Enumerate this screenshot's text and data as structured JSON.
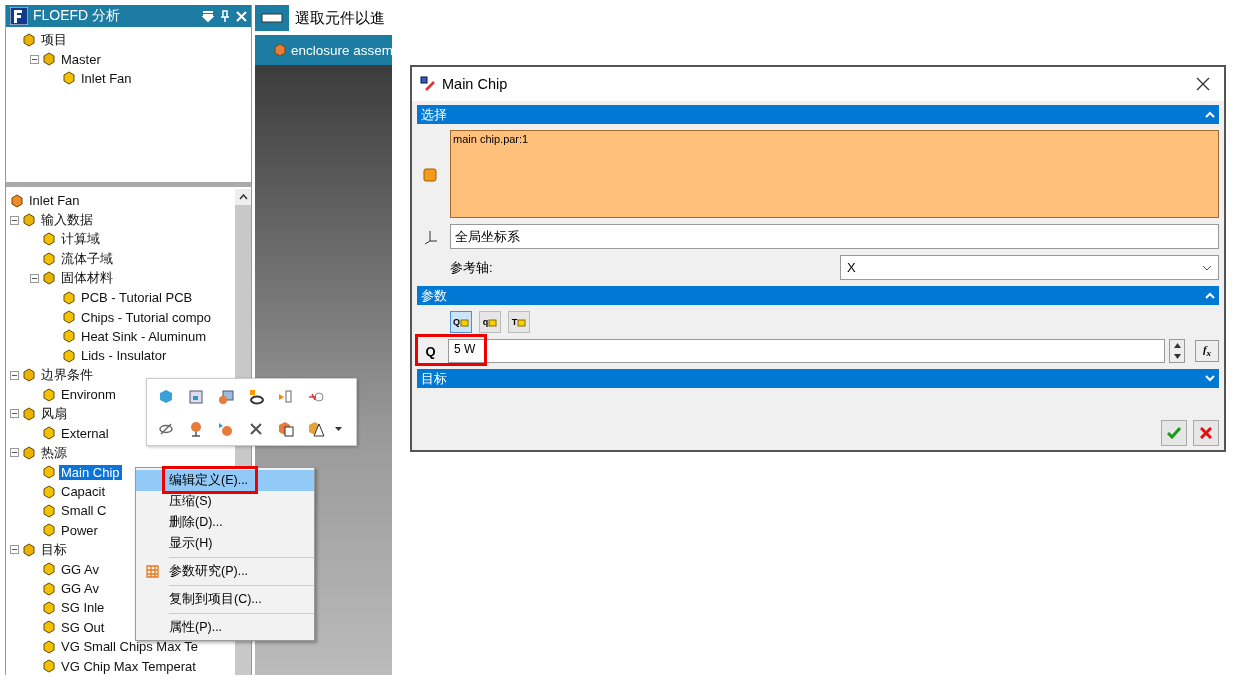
{
  "analysis_panel": {
    "title": "FLOEFD 分析",
    "project_tree": [
      {
        "label": "项目",
        "children": [
          {
            "label": "Master",
            "expanded": true,
            "children": [
              {
                "label": "Inlet Fan"
              }
            ]
          }
        ]
      }
    ]
  },
  "feature_tree": {
    "root": "Inlet Fan",
    "items": [
      {
        "label": "输入数据",
        "expanded": true,
        "children": [
          {
            "label": "计算域"
          },
          {
            "label": "流体子域"
          },
          {
            "label": "固体材料",
            "expanded": true,
            "children": [
              {
                "label": "PCB - Tutorial PCB"
              },
              {
                "label": "Chips - Tutorial compo"
              },
              {
                "label": "Heat Sink - Aluminum"
              },
              {
                "label": "Lids - Insulator"
              }
            ]
          }
        ]
      },
      {
        "label": "边界条件",
        "expanded": true,
        "children": [
          {
            "label": "Environm"
          }
        ]
      },
      {
        "label": "风扇",
        "expanded": true,
        "children": [
          {
            "label": "External"
          }
        ]
      },
      {
        "label": "热源",
        "expanded": true,
        "children": [
          {
            "label": "Main Chip",
            "selected": true
          },
          {
            "label": "Capacit",
            "selected": false
          },
          {
            "label": "Small C",
            "selected": false
          },
          {
            "label": "Power",
            "selected": false
          }
        ]
      },
      {
        "label": "目标",
        "expanded": true,
        "children": [
          {
            "label": "GG Av"
          },
          {
            "label": "GG Av"
          },
          {
            "label": "SG Inle"
          },
          {
            "label": "SG Out"
          },
          {
            "label": "VG Small Chips Max Te"
          },
          {
            "label": "VG Chip Max Temperat"
          }
        ]
      }
    ]
  },
  "viewport": {
    "hint": "選取元件以進",
    "tab": "enclosure assem"
  },
  "context_menu": {
    "items": [
      {
        "kind": "item",
        "label": "编辑定义(E)...",
        "selected": true,
        "highlighted": true
      },
      {
        "kind": "item",
        "label": "压缩(S)",
        "selected": false
      },
      {
        "kind": "item",
        "label": "删除(D)...",
        "selected": false
      },
      {
        "kind": "item",
        "label": "显示(H)",
        "selected": false
      },
      {
        "kind": "separator"
      },
      {
        "kind": "study",
        "label": "参数研究(P)...",
        "selected": false
      },
      {
        "kind": "separator"
      },
      {
        "kind": "item",
        "label": "复制到项目(C)...",
        "selected": false
      },
      {
        "kind": "separator"
      },
      {
        "kind": "item",
        "label": "属性(P)...",
        "selected": false
      }
    ]
  },
  "dialog": {
    "title": "Main Chip",
    "sections": [
      {
        "kind": "selection",
        "title": "选择",
        "expanded": true,
        "items": [
          "main chip.par:1"
        ],
        "coordinate_system": "全局坐标系",
        "axis_label": "参考轴:",
        "axis_value": "X"
      },
      {
        "kind": "parameters",
        "title": "参数",
        "expanded": true,
        "modes": [
          {
            "label": "Q",
            "selected": true
          },
          {
            "label": "q",
            "selected": false
          },
          {
            "label": "T",
            "selected": false
          }
        ],
        "label": "Q",
        "value": "5 W",
        "highlighted": true,
        "formula": "f$_{x}$"
      },
      {
        "kind": "goals",
        "title": "目标",
        "expanded": false
      }
    ],
    "buttons": [
      {
        "kind": "ok"
      },
      {
        "kind": "cancel"
      }
    ]
  }
}
